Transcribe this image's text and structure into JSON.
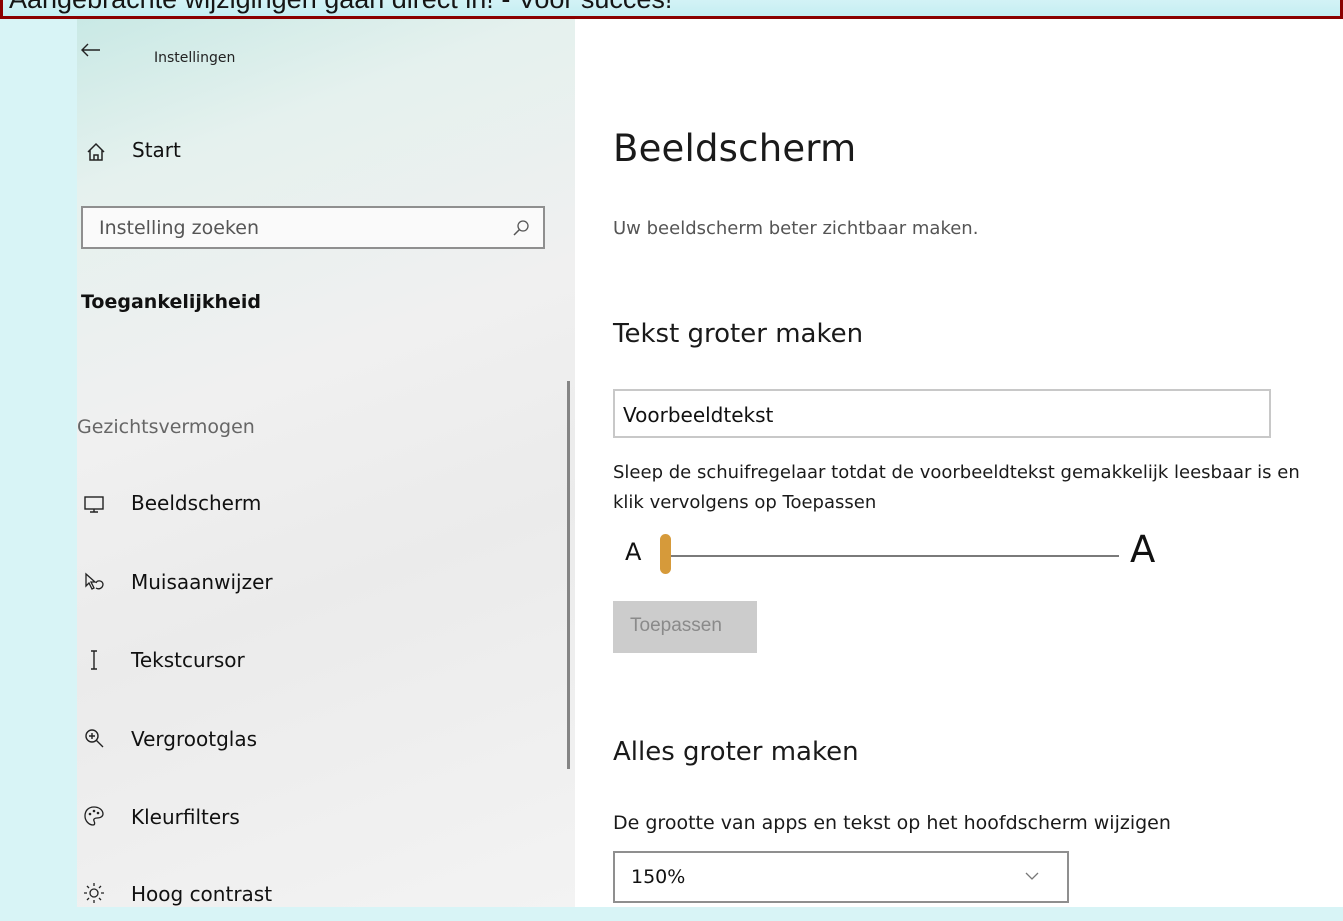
{
  "banner": {
    "text": "Aangebrachte wijzigingen gaan direct in! - Voor succes!"
  },
  "window": {
    "title": "Instellingen"
  },
  "sidebar": {
    "home_label": "Start",
    "search_placeholder": "Instelling zoeken",
    "section_title": "Toegankelijkheid",
    "group_label": "Gezichtsvermogen",
    "items": [
      {
        "label": "Beeldscherm",
        "icon": "monitor-icon"
      },
      {
        "label": "Muisaanwijzer",
        "icon": "mouse-pointer-icon"
      },
      {
        "label": "Tekstcursor",
        "icon": "text-cursor-icon"
      },
      {
        "label": "Vergrootglas",
        "icon": "magnifier-icon"
      },
      {
        "label": "Kleurfilters",
        "icon": "color-filter-icon"
      },
      {
        "label": "Hoog contrast",
        "icon": "contrast-icon"
      }
    ]
  },
  "main": {
    "title": "Beeldscherm",
    "subtitle": "Uw beeldscherm beter zichtbaar maken.",
    "text_size": {
      "heading": "Tekst groter maken",
      "sample_text": "Voorbeeldtekst",
      "instructions": "Sleep de schuifregelaar totdat de voorbeeldtekst gemakkelijk leesbaar is en klik vervolgens op Toepassen",
      "slider_min_label": "A",
      "slider_max_label": "A",
      "slider_value_fraction": 0.0,
      "apply_label": "Toepassen"
    },
    "everything_size": {
      "heading": "Alles groter maken",
      "description": "De grootte van apps en tekst op het hoofdscherm wijzigen",
      "selected_value": "150%"
    }
  },
  "colors": {
    "banner_border": "#8b0000",
    "slider_thumb": "#d69a3a",
    "disabled_button": "#cccccc"
  }
}
